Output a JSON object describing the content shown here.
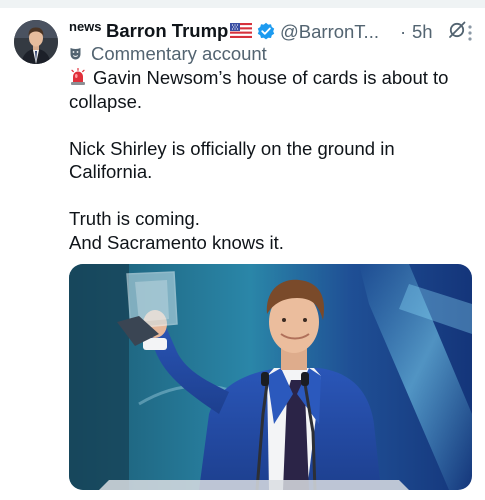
{
  "tweet": {
    "author_tag": "news",
    "author_name": "Barron Trump",
    "author_flag": "us-flag-icon",
    "handle": "@BarronT...",
    "separator": "·",
    "time": "5h",
    "commentary_label": "Commentary account",
    "siren_icon": "police-light-emoji",
    "lines": [
      "Gavin Newsom’s house of cards is about to",
      "collapse.",
      "",
      "Nick Shirley is officially on the ground in",
      "California.",
      "",
      "Truth is coming.",
      "And Sacramento knows it."
    ]
  },
  "colors": {
    "text": "#0f1419",
    "secondary": "#536471",
    "verified": "#1d9bf0",
    "divider": "#eff3f4"
  }
}
